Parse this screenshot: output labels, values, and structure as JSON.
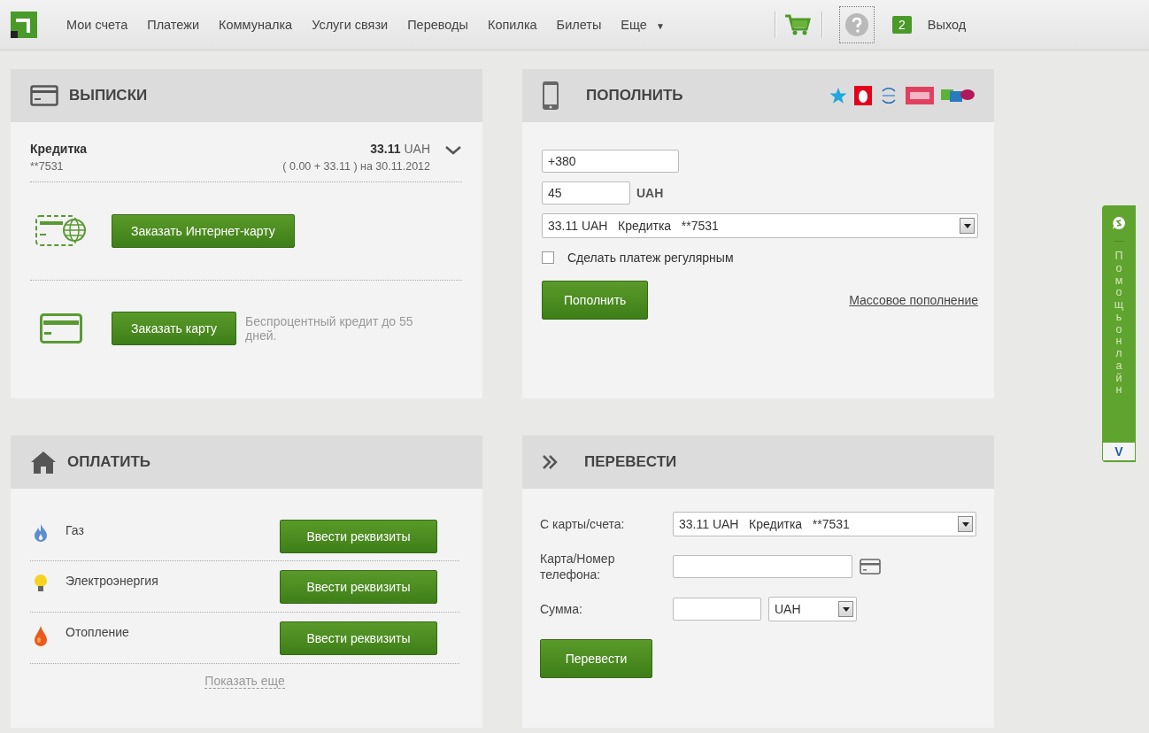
{
  "nav": {
    "items": [
      {
        "label": "Мои счета"
      },
      {
        "label": "Платежи"
      },
      {
        "label": "Коммуналка"
      },
      {
        "label": "Услуги связи"
      },
      {
        "label": "Переводы"
      },
      {
        "label": "Копилка"
      },
      {
        "label": "Билеты"
      }
    ],
    "more": "Еще",
    "more_caret": "▼",
    "messages": "2",
    "logout": "Выход"
  },
  "statements": {
    "title": "ВЫПИСКИ",
    "account": {
      "name": "Кредитка",
      "number": "**7531",
      "amount": "33.11",
      "currency": "UAH",
      "detail": "( 0.00 + 33.11 ) на 30.11.2012",
      "expanded": false
    },
    "offers": [
      {
        "kind": "internet-card",
        "button": "Заказать Интернет-карту"
      },
      {
        "kind": "card",
        "button": "Заказать карту",
        "note": "Беспроцентный кредит до 55 дней."
      }
    ]
  },
  "topup": {
    "title": "ПОПОЛНИТЬ",
    "phone": "+380",
    "amount": "45",
    "currency": "UAH",
    "source": "33.11 UAH   Кредитка   **7531",
    "regular": {
      "label": "Сделать платеж регулярным",
      "checked": false
    },
    "button": "Пополнить",
    "bulk_link": "Массовое пополнение"
  },
  "pay": {
    "title": "ОПЛАТИТЬ",
    "services": [
      {
        "kind": "gas",
        "label": "Газ",
        "button": "Ввести реквизиты"
      },
      {
        "kind": "electricity",
        "label": "Электроэнергия",
        "button": "Ввести реквизиты"
      },
      {
        "kind": "heating",
        "label": "Отопление",
        "button": "Ввести реквизиты"
      }
    ],
    "show_more": "Показать еще"
  },
  "transfer": {
    "title": "ПЕРЕВЕСТИ",
    "from_label": "С карты/счета:",
    "from_value": "33.11 UAH   Кредитка   **7531",
    "to_label": "Карта/Номер телефона:",
    "amount_label": "Сумма:",
    "currency": "UAH",
    "button": "Перевести"
  },
  "help_tab": {
    "label": "Помощь онлайн",
    "toggle": "V"
  }
}
